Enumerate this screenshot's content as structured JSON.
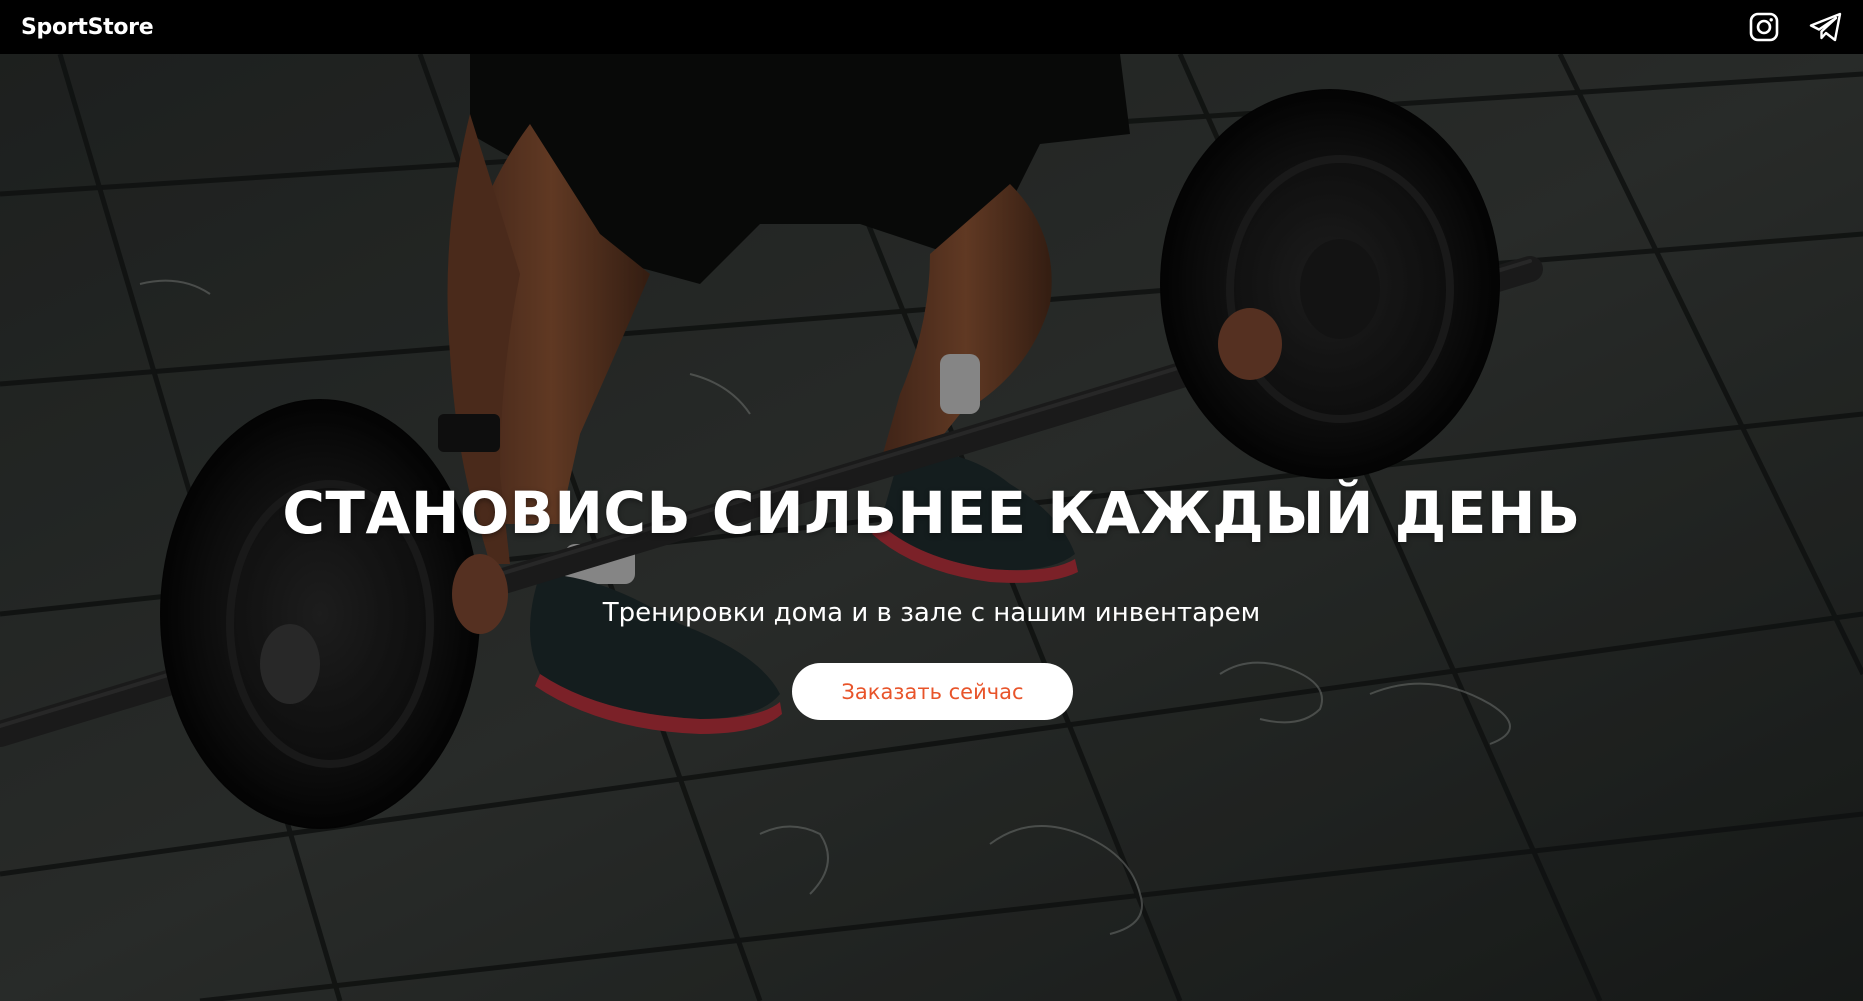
{
  "header": {
    "logo": "SportStore",
    "social": [
      {
        "name": "instagram",
        "icon": "instagram-icon"
      },
      {
        "name": "telegram",
        "icon": "telegram-icon"
      }
    ]
  },
  "hero": {
    "background_image": "athlete-deadlift-barbell-photo",
    "title": "СТАНОВИСЬ СИЛЬНЕЕ КАЖДЫЙ ДЕНЬ",
    "subtitle": "Тренировки дома и в зале с нашим инвентарем",
    "cta_label": "Заказать сейчас"
  },
  "colors": {
    "header_bg": "#000000",
    "text": "#ffffff",
    "accent": "#e8542a",
    "button_bg": "#ffffff"
  }
}
